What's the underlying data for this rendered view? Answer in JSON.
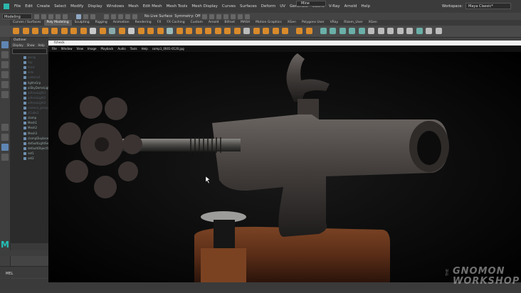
{
  "menubar": {
    "items": [
      "File",
      "Edit",
      "Create",
      "Select",
      "Modify",
      "Display",
      "Windows",
      "Mesh",
      "Edit Mesh",
      "Mesh Tools",
      "Mesh Display",
      "Curves",
      "Surfaces",
      "Deform",
      "UV",
      "Generate",
      "Cache",
      "V-Ray",
      "Arnold",
      "Help"
    ],
    "workspace_label": "Workspace:",
    "workspace_value": "Maya Classic*"
  },
  "statusline": {
    "mode": "Modeling",
    "live_surface": "No Live Surface",
    "symmetry": "Symmetry: Off",
    "renderer": "Mine"
  },
  "shelf": {
    "tabs": [
      "Curves / Surfaces",
      "Poly Modeling",
      "Sculpting",
      "Rigging",
      "Animation",
      "Rendering",
      "FX",
      "FX Caching",
      "Custom",
      "Arnold",
      "Bifrost",
      "MASH",
      "Motion Graphics",
      "XGen",
      "Polygons User",
      "VRay",
      "Rizom_User",
      "XGen"
    ],
    "active_tab": "Poly Modeling"
  },
  "outliner": {
    "title": "Outliner",
    "menus": [
      "Display",
      "Show",
      "Help"
    ],
    "rows": [
      {
        "label": "persp",
        "dim": true
      },
      {
        "label": "top",
        "dim": true
      },
      {
        "label": "front",
        "dim": true
      },
      {
        "label": "side",
        "dim": true
      },
      {
        "label": "camera1",
        "dim": true
      },
      {
        "label": "lightsGrp",
        "dim": false
      },
      {
        "label": "aiSkyDomeLight1",
        "dim": false
      },
      {
        "label": "aiAreaLight1",
        "dim": true
      },
      {
        "label": "aiAreaLight2",
        "dim": true
      },
      {
        "label": "aiAreaLight3",
        "dim": true
      },
      {
        "label": "camera_group",
        "dim": true
      },
      {
        "label": "pCube1",
        "dim": true
      },
      {
        "label": "clamp",
        "dim": false
      },
      {
        "label": "Mesh1",
        "dim": false
      },
      {
        "label": "Mesh2",
        "dim": false
      },
      {
        "label": "Mesh3",
        "dim": false
      },
      {
        "label": "clampDisplacement",
        "dim": false
      },
      {
        "label": "defaultLightSet",
        "dim": false
      },
      {
        "label": "defaultObjectSet",
        "dim": false
      },
      {
        "label": "set1",
        "dim": false
      },
      {
        "label": "set2",
        "dim": false
      }
    ]
  },
  "cmdline": {
    "label": "MEL"
  },
  "viewer": {
    "title": "fcheck",
    "menu": [
      "File",
      "Window",
      "View",
      "Image",
      "Playback",
      "Audio",
      "Tools",
      "Help"
    ],
    "filename": "comp1_0001-0120.jpg"
  },
  "watermark": {
    "the": "THE",
    "line1": "GNOMON",
    "line2": "WORKSHOP"
  },
  "colors": {
    "accent": "#5f86b3",
    "maya_logo": "#23c0b8",
    "shelf_orange": "#d98a2b"
  }
}
